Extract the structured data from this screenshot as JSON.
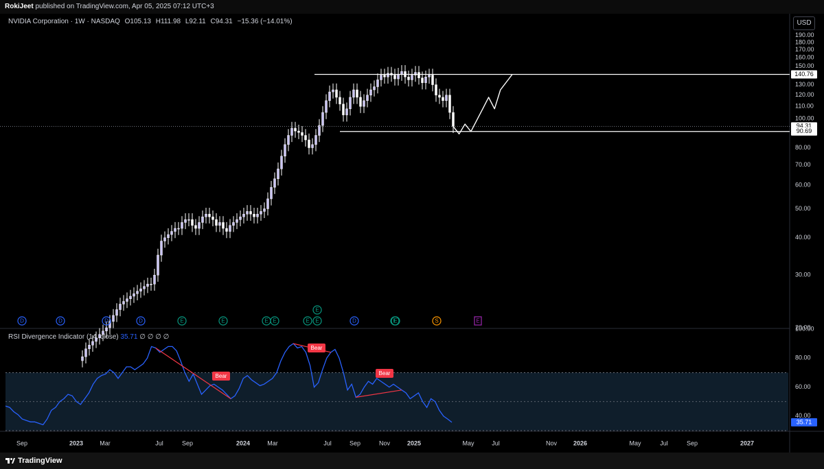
{
  "header": {
    "publisher": "RokiJeet",
    "published_text": "published on TradingView.com, Apr 05, 2025 07:12 UTC+3"
  },
  "legend": {
    "title": "NVIDIA Corporation · 1W · NASDAQ",
    "open": "O105.13",
    "high": "H111.98",
    "low": "L92.11",
    "close": "C94.31",
    "change": "−15.36 (−14.01%)"
  },
  "currency": "USD",
  "rsi_legend": {
    "title": "RSI Divergence Indicator (14, close)",
    "value": "35.71",
    "extras": "∅ ∅ ∅ ∅"
  },
  "footer": {
    "brand": "TradingView"
  },
  "colors": {
    "up": "#c9c3f5",
    "down": "#ffffff",
    "rsi_line": "#2962ff",
    "bear": "#f23645",
    "band": "#0f1e2b",
    "grid": "#2a2e39",
    "dividend": "#2962ff",
    "earnings": "#089981",
    "split": "#ff9800",
    "future_earnings": "#9c27b0"
  },
  "chart_data": [
    {
      "type": "candlestick",
      "title": "NVIDIA Corporation · 1W · NASDAQ",
      "yticks": [
        20,
        30,
        40,
        50,
        60,
        70,
        80,
        90,
        100,
        110,
        120,
        130,
        140,
        150,
        160,
        170,
        180,
        190
      ],
      "ylim": [
        20,
        200
      ],
      "scale": "log",
      "xticks": [
        "Sep",
        "2023",
        "Mar",
        "Jul",
        "Sep",
        "2024",
        "Mar",
        "Jul",
        "Sep",
        "Nov",
        "2025",
        "May",
        "Jul",
        "Nov",
        "2026",
        "May",
        "Jul",
        "Sep",
        "2027"
      ],
      "price_labels": [
        {
          "value": 140.76,
          "text": "140.76"
        },
        {
          "value": 94.31,
          "text": "94.31"
        },
        {
          "value": 90.69,
          "text": "90.69"
        }
      ],
      "horizontal_lines": [
        140.76,
        90.69
      ],
      "last_price": 94.31,
      "candles_close": [
        16,
        17,
        17.5,
        18,
        18.5,
        19,
        19.5,
        20,
        21,
        22,
        23,
        24,
        24.5,
        25,
        25.5,
        26,
        26.5,
        27,
        27.5,
        28,
        28,
        30,
        35,
        39,
        40,
        41,
        42,
        43,
        43,
        45,
        46,
        46,
        44,
        43,
        45,
        47,
        48,
        47,
        46,
        44,
        45,
        43,
        42,
        44,
        45,
        46,
        47,
        48,
        49,
        48,
        47,
        48,
        49,
        50,
        54,
        59,
        63,
        68,
        75,
        82,
        88,
        93,
        91,
        90,
        88,
        85,
        80,
        82,
        88,
        95,
        105,
        115,
        123,
        125,
        118,
        112,
        103,
        108,
        118,
        125,
        118,
        110,
        115,
        120,
        125,
        128,
        135,
        140,
        138,
        142,
        140,
        136,
        141,
        144,
        138,
        135,
        140,
        143,
        137,
        132,
        138,
        140,
        130,
        120,
        118,
        115,
        120,
        105,
        94.31
      ],
      "drawn_projection": [
        {
          "t": 0,
          "v": 94.31
        },
        {
          "t": 1,
          "v": 89
        },
        {
          "t": 2,
          "v": 96
        },
        {
          "t": 3,
          "v": 90.69
        },
        {
          "t": 5,
          "v": 108
        },
        {
          "t": 6,
          "v": 118
        },
        {
          "t": 7,
          "v": 108
        },
        {
          "t": 8,
          "v": 125
        },
        {
          "t": 10,
          "v": 140.76
        }
      ],
      "event_markers": [
        {
          "type": "D"
        },
        {
          "type": "D"
        },
        {
          "type": "D"
        },
        {
          "type": "D"
        },
        {
          "type": "E"
        },
        {
          "type": "E"
        },
        {
          "type": "E"
        },
        {
          "type": "E"
        },
        {
          "type": "E"
        },
        {
          "type": "D"
        },
        {
          "type": "E"
        },
        {
          "type": "S"
        },
        {
          "type": "E"
        },
        {
          "type": "E"
        },
        {
          "type": "E"
        },
        {
          "type": "E"
        }
      ]
    },
    {
      "type": "line",
      "title": "RSI Divergence Indicator (14, close)",
      "ylim": [
        30,
        100
      ],
      "yticks": [
        40,
        60,
        80,
        100
      ],
      "band": [
        30,
        70
      ],
      "last_value": 35.71,
      "series": [
        {
          "values": [
            47,
            46,
            43,
            41,
            38,
            37,
            36,
            36,
            35,
            34,
            38,
            44,
            46,
            50,
            52,
            55,
            54,
            50,
            48,
            52,
            56,
            62,
            66,
            68,
            69,
            72,
            70,
            66,
            70,
            74,
            74,
            72,
            74,
            76,
            80,
            88,
            87,
            84,
            86,
            88,
            88,
            85,
            78,
            70,
            64,
            69,
            62,
            55,
            58,
            61,
            62,
            60,
            58,
            55,
            52,
            54,
            59,
            66,
            68,
            65,
            63,
            61,
            62,
            64,
            66,
            70,
            78,
            84,
            88,
            90,
            87,
            88,
            84,
            75,
            60,
            63,
            72,
            80,
            84,
            86,
            80,
            70,
            58,
            62,
            53,
            55,
            60,
            64,
            62,
            66,
            64,
            62,
            60,
            62,
            60,
            58,
            56,
            52,
            54,
            56,
            50,
            46,
            52,
            50,
            44,
            40,
            38,
            35.71
          ]
        }
      ],
      "annotations": [
        {
          "text": "Bear"
        },
        {
          "text": "Bear"
        },
        {
          "text": "Bear"
        }
      ]
    }
  ]
}
